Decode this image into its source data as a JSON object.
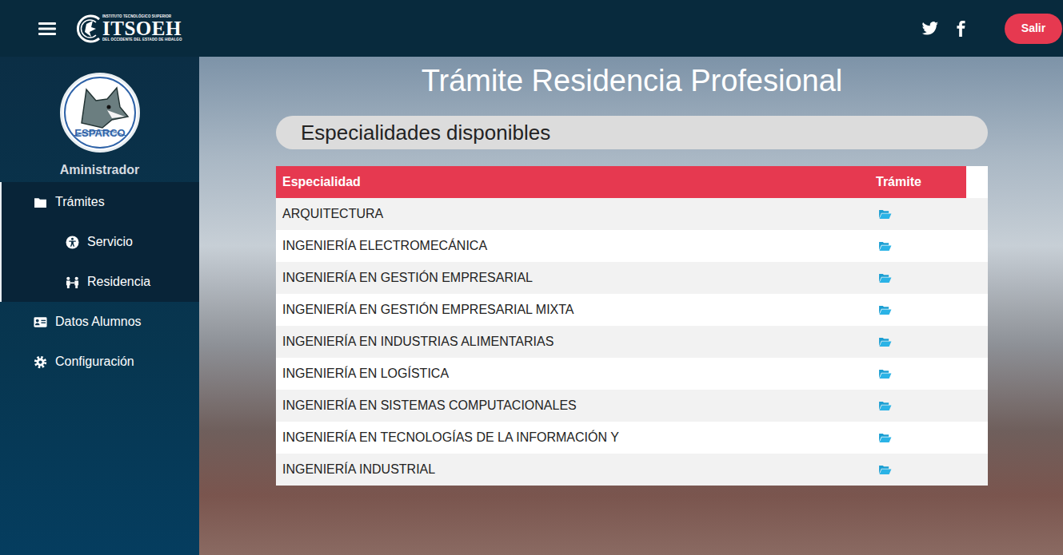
{
  "header": {
    "logo": {
      "top": "INSTITUTO TECNOLÓGICO SUPERIOR",
      "title": "ITSOEH",
      "bottom": "DEL OCCIDENTE DEL ESTADO DE HIDALGO"
    },
    "exit_button": "Salir"
  },
  "sidebar": {
    "avatar_text": "ESPARCO",
    "user": "Aministrador",
    "items": [
      {
        "label": "Trámites",
        "kind": "parent",
        "expanded": true
      },
      {
        "label": "Servicio",
        "kind": "child",
        "expanded": false
      },
      {
        "label": "Residencia",
        "kind": "child",
        "expanded": false
      },
      {
        "label": "Datos Alumnos",
        "kind": "parent",
        "expanded": false
      },
      {
        "label": "Configuración",
        "kind": "parent",
        "expanded": false
      }
    ]
  },
  "page": {
    "title": "Trámite Residencia Profesional",
    "subtitle": "Especialidades disponibles"
  },
  "table": {
    "columns": [
      "Especialidad",
      "Trámite"
    ],
    "rows": [
      [
        "ARQUITECTURA"
      ],
      [
        "INGENIERÍA ELECTROMECÁNICA"
      ],
      [
        "INGENIERÍA EN GESTIÓN EMPRESARIAL"
      ],
      [
        "INGENIERÍA EN GESTIÓN EMPRESARIAL MIXTA"
      ],
      [
        "INGENIERÍA EN INDUSTRIAS ALIMENTARIAS"
      ],
      [
        "INGENIERÍA EN LOGÍSTICA"
      ],
      [
        "INGENIERÍA EN SISTEMAS COMPUTACIONALES"
      ],
      [
        "INGENIERÍA EN TECNOLOGÍAS DE LA INFORMACIÓN Y"
      ],
      [
        "INGENIERÍA INDUSTRIAL"
      ]
    ]
  }
}
